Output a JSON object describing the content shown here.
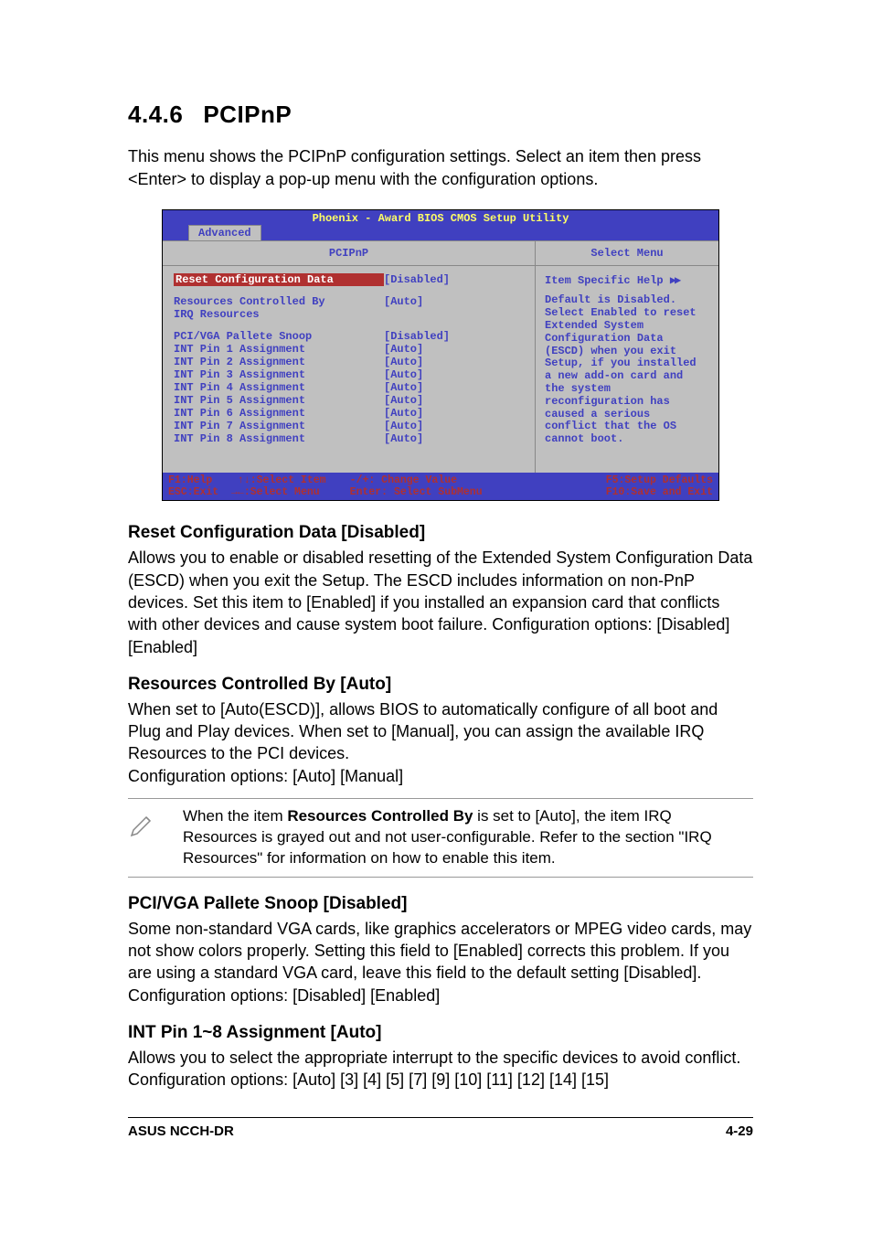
{
  "section": {
    "number": "4.4.6",
    "title": "PCIPnP"
  },
  "intro": "This menu shows the PCIPnP configuration settings. Select an item then press <Enter> to display a pop-up menu with the configuration options.",
  "bios": {
    "title": "Phoenix - Award BIOS CMOS Setup Utility",
    "tab": "Advanced",
    "left_header": "PCIPnP",
    "right_header": "Select Menu",
    "items": [
      {
        "label": "Reset Configuration Data",
        "value": "[Disabled]",
        "highlight": true
      },
      {
        "gap": true
      },
      {
        "label": "Resources Controlled By",
        "value": "[Auto]"
      },
      {
        "label": "IRQ Resources",
        "value": ""
      },
      {
        "gap": true
      },
      {
        "label": "PCI/VGA Pallete Snoop",
        "value": "[Disabled]"
      },
      {
        "label": "INT Pin 1 Assignment",
        "value": "[Auto]"
      },
      {
        "label": "INT Pin 2 Assignment",
        "value": "[Auto]"
      },
      {
        "label": "INT Pin 3 Assignment",
        "value": "[Auto]"
      },
      {
        "label": "INT Pin 4 Assignment",
        "value": "[Auto]"
      },
      {
        "label": "INT Pin 5 Assignment",
        "value": "[Auto]"
      },
      {
        "label": "INT Pin 6 Assignment",
        "value": "[Auto]"
      },
      {
        "label": "INT Pin 7 Assignment",
        "value": "[Auto]"
      },
      {
        "label": "INT Pin 8 Assignment",
        "value": "[Auto]"
      }
    ],
    "help_title": "Item Specific Help",
    "help_text": "Default is Disabled. Select Enabled to reset Extended System Configuration Data (ESCD) when you exit Setup, if you installed a new add-on card and the system reconfiguration has caused a serious conflict that the OS cannot boot.",
    "footer": {
      "l1a": "F1:Help",
      "l1b": "↑↓:Select Item",
      "l1c": "-/+: Change Value",
      "l1d": "F5:Setup Defaults",
      "l2a": "ESC:Exit",
      "l2b": "→←:Select Menu",
      "l2c": "Enter: Select SubMenu",
      "l2d": "F10:Save and Exit"
    }
  },
  "subsections": [
    {
      "heading": "Reset Configuration Data [Disabled]",
      "body": "Allows you to enable or disabled resetting of the Extended System Configuration Data (ESCD) when you exit the Setup. The ESCD includes information on non-PnP devices. Set this item to [Enabled] if you installed an expansion card that conflicts with other devices and cause system boot failure. Configuration options: [Disabled] [Enabled]"
    },
    {
      "heading": "Resources Controlled By [Auto]",
      "body": "When set to [Auto(ESCD)], allows BIOS to automatically configure of all boot and Plug and Play devices. When set to [Manual], you can assign the available IRQ Resources to the PCI devices.\nConfiguration options: [Auto] [Manual]",
      "note_pre": "When the item ",
      "note_bold": "Resources Controlled By",
      "note_post": " is set to [Auto], the item IRQ Resources is grayed out and not user-configurable. Refer to the section \"IRQ Resources\" for information on how to enable this item."
    },
    {
      "heading": "PCI/VGA Pallete Snoop [Disabled]",
      "body": "Some non-standard VGA cards, like graphics accelerators or MPEG video cards, may not show colors properly. Setting this field to [Enabled] corrects this problem. If you are using a standard VGA card, leave this field to the default setting [Disabled]. Configuration options: [Disabled] [Enabled]"
    },
    {
      "heading": "INT Pin 1~8 Assignment [Auto]",
      "body": "Allows you to select the appropriate interrupt to the specific devices to avoid conflict. Configuration options: [Auto] [3] [4] [5] [7] [9] [10] [11] [12] [14] [15]"
    }
  ],
  "footer": {
    "left": "ASUS NCCH-DR",
    "right": "4-29"
  }
}
